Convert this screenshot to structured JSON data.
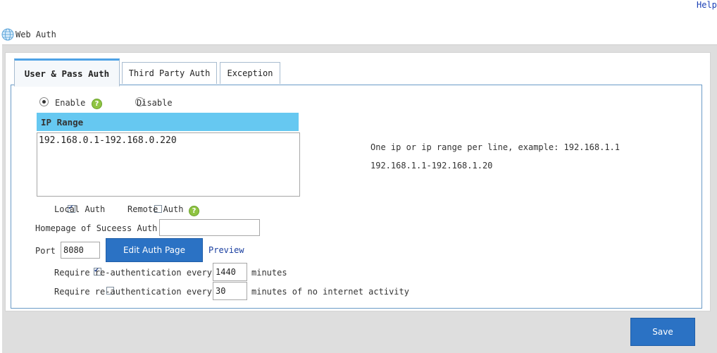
{
  "header": {
    "help_label": "Help",
    "title": "Web Auth",
    "icon": "globe-icon"
  },
  "tabs": [
    {
      "label": "User & Pass Auth",
      "active": true
    },
    {
      "label": "Third Party Auth",
      "active": false
    },
    {
      "label": "Exception",
      "active": false
    }
  ],
  "status": {
    "enable_label": "Enable",
    "disable_label": "Disable",
    "selected": "Enable"
  },
  "ip_range": {
    "header": "IP Range",
    "value": "192.168.0.1-192.168.0.220",
    "hint_line1": "One ip or ip range per line, example: 192.168.1.1",
    "hint_line2": "192.168.1.1-192.168.1.20"
  },
  "auth_types": {
    "local_label": "Local Auth",
    "local_checked": true,
    "remote_label": "Remote Auth",
    "remote_checked": false
  },
  "homepage": {
    "label": "Homepage of Suceess Auth",
    "value": ""
  },
  "port": {
    "label": "Port",
    "value": "8080"
  },
  "buttons": {
    "edit_auth_page": "Edit Auth Page",
    "preview": "Preview",
    "save": "Save"
  },
  "reauth": {
    "label": "Require re-authentication every",
    "every_checked": true,
    "every_value": "1440",
    "every_unit": "minutes",
    "idle_checked": false,
    "idle_value": "30",
    "idle_unit": "minutes of no internet activity"
  },
  "colors": {
    "accent_blue": "#2b72c4",
    "ip_header_bg": "#66c8f1",
    "tab_active_bar": "#4fa3e6",
    "help_icon_green": "#8fc442"
  }
}
